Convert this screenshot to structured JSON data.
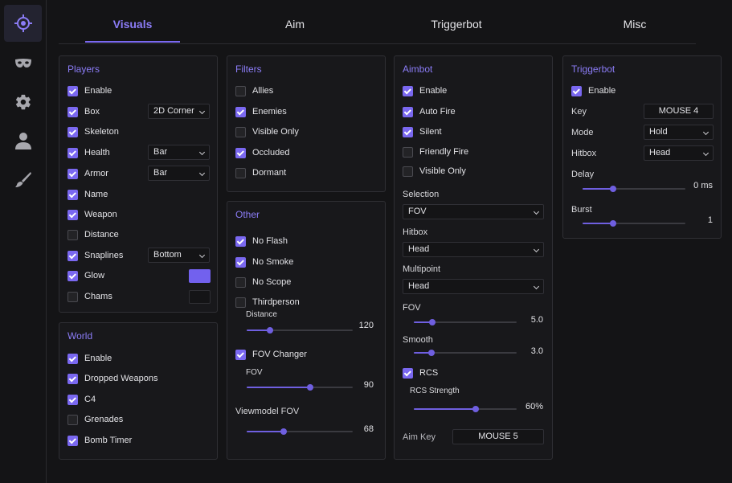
{
  "sidebar": {
    "items": [
      "crosshair-icon",
      "mask-icon",
      "gear-icon",
      "user-icon",
      "brush-icon"
    ]
  },
  "tabs": [
    "Visuals",
    "Aim",
    "Triggerbot",
    "Misc"
  ],
  "colors": {
    "accent": "#7a68f0",
    "glow": "#7261ee",
    "chams": "#141416"
  },
  "players": {
    "title": "Players",
    "enable": {
      "label": "Enable",
      "checked": true
    },
    "box": {
      "label": "Box",
      "checked": true,
      "select": "2D Corner"
    },
    "skeleton": {
      "label": "Skeleton",
      "checked": true
    },
    "health": {
      "label": "Health",
      "checked": true,
      "select": "Bar"
    },
    "armor": {
      "label": "Armor",
      "checked": true,
      "select": "Bar"
    },
    "name": {
      "label": "Name",
      "checked": true
    },
    "weapon": {
      "label": "Weapon",
      "checked": true
    },
    "distance": {
      "label": "Distance",
      "checked": false
    },
    "snaplines": {
      "label": "Snaplines",
      "checked": true,
      "select": "Bottom"
    },
    "glow": {
      "label": "Glow",
      "checked": true
    },
    "chams": {
      "label": "Chams",
      "checked": false
    }
  },
  "world": {
    "title": "World",
    "enable": {
      "label": "Enable",
      "checked": true
    },
    "dropped": {
      "label": "Dropped Weapons",
      "checked": true
    },
    "c4": {
      "label": "C4",
      "checked": true
    },
    "grenades": {
      "label": "Grenades",
      "checked": false
    },
    "bomb": {
      "label": "Bomb Timer",
      "checked": true
    }
  },
  "filters": {
    "title": "Filters",
    "allies": {
      "label": "Allies",
      "checked": false
    },
    "enemies": {
      "label": "Enemies",
      "checked": true
    },
    "visible": {
      "label": "Visible Only",
      "checked": false
    },
    "occluded": {
      "label": "Occluded",
      "checked": true
    },
    "dormant": {
      "label": "Dormant",
      "checked": false
    }
  },
  "other": {
    "title": "Other",
    "noflash": {
      "label": "No Flash",
      "checked": true
    },
    "nosmoke": {
      "label": "No Smoke",
      "checked": true
    },
    "noscope": {
      "label": "No Scope",
      "checked": false
    },
    "thirdperson": {
      "label": "Thirdperson",
      "checked": false
    },
    "distance": {
      "label": "Distance",
      "value": "120",
      "fraction": 0.22
    },
    "fovchanger": {
      "label": "FOV Changer",
      "checked": true
    },
    "fov": {
      "label": "FOV",
      "value": "90",
      "fraction": 0.6
    },
    "viewmodel": {
      "label": "Viewmodel FOV",
      "value": "68",
      "fraction": 0.35
    }
  },
  "aimbot": {
    "title": "Aimbot",
    "enable": {
      "label": "Enable",
      "checked": true
    },
    "autofire": {
      "label": "Auto Fire",
      "checked": true
    },
    "silent": {
      "label": "Silent",
      "checked": true
    },
    "friendly": {
      "label": "Friendly Fire",
      "checked": false
    },
    "visible": {
      "label": "Visible Only",
      "checked": false
    },
    "selection": {
      "label": "Selection",
      "value": "FOV"
    },
    "hitbox": {
      "label": "Hitbox",
      "value": "Head"
    },
    "multipoint": {
      "label": "Multipoint",
      "value": "Head"
    },
    "fov": {
      "label": "FOV",
      "value": "5.0",
      "fraction": 0.18
    },
    "smooth": {
      "label": "Smooth",
      "value": "3.0",
      "fraction": 0.17
    },
    "rcs": {
      "label": "RCS",
      "checked": true
    },
    "rcs_strength": {
      "label": "RCS Strength",
      "value": "60%",
      "fraction": 0.6
    },
    "aimkey": {
      "label": "Aim Key",
      "value": "MOUSE 5"
    }
  },
  "triggerbot": {
    "title": "Triggerbot",
    "enable": {
      "label": "Enable",
      "checked": true
    },
    "key": {
      "label": "Key",
      "value": "MOUSE 4"
    },
    "mode": {
      "label": "Mode",
      "value": "Hold"
    },
    "hitbox": {
      "label": "Hitbox",
      "value": "Head"
    },
    "delay": {
      "label": "Delay",
      "value": "0 ms",
      "fraction": 0.3
    },
    "burst": {
      "label": "Burst",
      "value": "1",
      "fraction": 0.3
    }
  }
}
